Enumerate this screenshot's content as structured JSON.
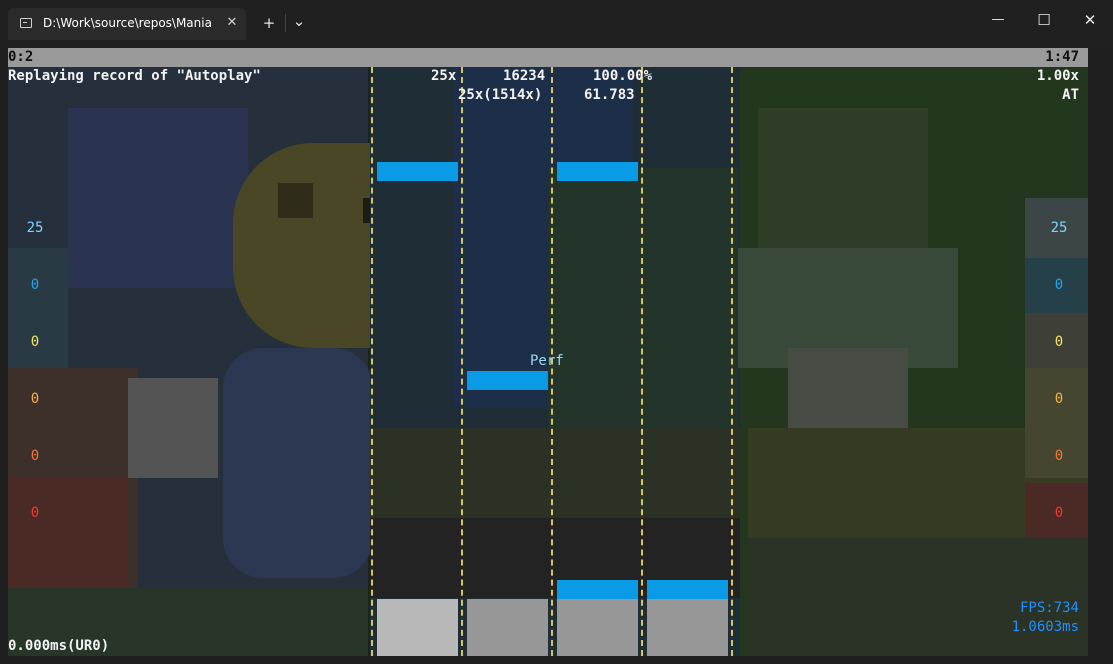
{
  "window": {
    "tab_title": "D:\\Work\\source\\repos\\Mania",
    "tab_close": "✕",
    "new_tab": "+",
    "dropdown": "⌄",
    "minimize": "—",
    "maximize": "☐",
    "close": "✕"
  },
  "status": {
    "elapsed": "0:2",
    "total": "1:47"
  },
  "header": {
    "replay_text": "Replaying record of \"Autoplay\"",
    "combo": "25x",
    "score": "16234",
    "accuracy": "100.00%",
    "max_combo": "25x(1514x)",
    "pp": "61.783",
    "speed": "1.00x",
    "mode": "AT"
  },
  "judgement_counts": {
    "left": [
      "25",
      "0",
      "0",
      "0",
      "0",
      "0"
    ],
    "right": [
      "25",
      "0",
      "0",
      "0",
      "0",
      "0"
    ],
    "colors": [
      "#7fd4ff",
      "#1aa6ef",
      "#f1e36b",
      "#f3b34a",
      "#ef7a35",
      "#ee3a32"
    ]
  },
  "judgement": "Perf",
  "footer": {
    "fps": "FPS:734",
    "frame_time": "1.0603ms",
    "unstable_rate": "0.000ms(UR0)"
  },
  "colors": {
    "note": "#0a9be6",
    "lane_divider": "#d8c45c",
    "status_bar": "#9a9a9a",
    "fps_text": "#1e90ff"
  }
}
